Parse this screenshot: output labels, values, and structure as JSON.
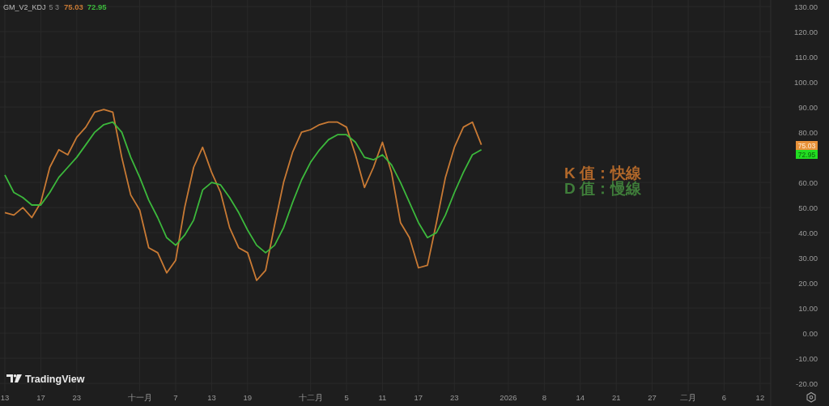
{
  "legend": {
    "name": "GM_V2_KDJ",
    "params": "5 3",
    "values": [
      {
        "text": "75.03",
        "color": "#c97a34"
      },
      {
        "text": "72.95",
        "color": "#3cb83c"
      }
    ]
  },
  "chart_data": {
    "type": "line",
    "categories": [
      "13",
      null,
      null,
      null,
      "17",
      null,
      null,
      null,
      "23",
      null,
      null,
      null,
      null,
      null,
      null,
      "十一月",
      null,
      null,
      null,
      "7",
      null,
      null,
      null,
      "13",
      null,
      null,
      null,
      "19",
      null,
      null,
      null,
      null,
      null,
      null,
      "十二月",
      null,
      null,
      null,
      "5",
      null,
      null,
      null,
      "11",
      null,
      null,
      null,
      "17",
      null,
      null,
      null,
      "23",
      null,
      null,
      null,
      null,
      null,
      "2026",
      null,
      null,
      null,
      "8",
      null,
      null,
      null,
      "14",
      null,
      null,
      null,
      "21",
      null,
      null,
      null,
      "27",
      null,
      null,
      null,
      "二月",
      null,
      null,
      null,
      "6",
      null,
      null,
      null,
      "12",
      null
    ],
    "series": [
      {
        "color": "#c97a34",
        "values": [
          48,
          47,
          50,
          46,
          52,
          66,
          73,
          71,
          78,
          82,
          88,
          89,
          88,
          70,
          55,
          49,
          34,
          32,
          24,
          29,
          50,
          66,
          74,
          64,
          56,
          42,
          34,
          32,
          21,
          25,
          43,
          60,
          72,
          80,
          81,
          83,
          84,
          84,
          82,
          71,
          58,
          66,
          76,
          64,
          44,
          38,
          26,
          27,
          44,
          62,
          74,
          82,
          84,
          75,
          null,
          null,
          null,
          null,
          null,
          null,
          null,
          null,
          null,
          null,
          null,
          null,
          null,
          null,
          null,
          null,
          null,
          null,
          null,
          null,
          null,
          null,
          null,
          null,
          null,
          null,
          null,
          null,
          null,
          null,
          null,
          null
        ]
      },
      {
        "color": "#3cb83c",
        "values": [
          63,
          56,
          54,
          51,
          51,
          56,
          62,
          66,
          70,
          75,
          80,
          83,
          84,
          80,
          70,
          62,
          53,
          46,
          38,
          35,
          39,
          45,
          57,
          60,
          59,
          54,
          48,
          41,
          35,
          32,
          35,
          42,
          52,
          61,
          68,
          73,
          77,
          79,
          79,
          76,
          70,
          69,
          71,
          67,
          60,
          52,
          44,
          38,
          40,
          47,
          56,
          64,
          71,
          73,
          null,
          null,
          null,
          null,
          null,
          null,
          null,
          null,
          null,
          null,
          null,
          null,
          null,
          null,
          null,
          null,
          null,
          null,
          null,
          null,
          null,
          null,
          null,
          null,
          null,
          null,
          null,
          null,
          null,
          null,
          null,
          null
        ]
      }
    ],
    "ylim": [
      -23.2,
      132.6
    ],
    "grid": true,
    "yticks": [
      {
        "value": 130,
        "label": "130.00"
      },
      {
        "value": 120,
        "label": "120.00"
      },
      {
        "value": 110,
        "label": "110.00"
      },
      {
        "value": 100,
        "label": "100.00"
      },
      {
        "value": 90,
        "label": "90.00"
      },
      {
        "value": 80,
        "label": "80.00"
      },
      {
        "value": 60,
        "label": "60.00"
      },
      {
        "value": 50,
        "label": "50.00"
      },
      {
        "value": 40,
        "label": "40.00"
      },
      {
        "value": 30,
        "label": "30.00"
      },
      {
        "value": 20,
        "label": "20.00"
      },
      {
        "value": 10,
        "label": "10.00"
      },
      {
        "value": 0,
        "label": "0.00"
      },
      {
        "value": -10,
        "label": "-10.00"
      },
      {
        "value": -20,
        "label": "-20.00"
      }
    ]
  },
  "notes": [
    {
      "text": "K 值：快線",
      "color": "#b0672a"
    },
    {
      "text": "D 值：慢線",
      "color": "#3f7d3a"
    }
  ],
  "price_tags": [
    {
      "text": "75.03",
      "color": "#e8923a"
    },
    {
      "text": "72.95",
      "color": "#22dd22"
    }
  ],
  "logo": "TradingView"
}
